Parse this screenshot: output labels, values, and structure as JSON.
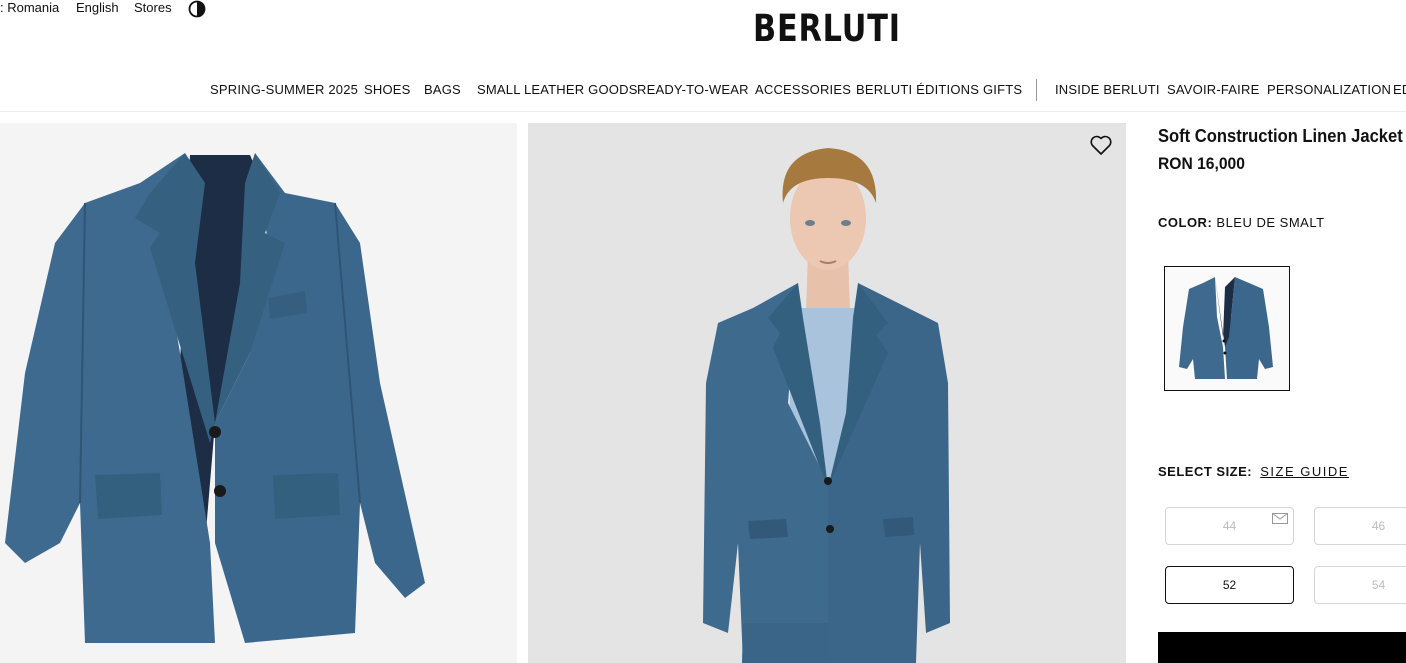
{
  "utility": {
    "country": ": Romania",
    "language": "English",
    "stores": "Stores"
  },
  "brand": "BERLUTI",
  "nav": {
    "items": [
      "SPRING-SUMMER 2025",
      "SHOES",
      "BAGS",
      "SMALL LEATHER GOODS",
      "READY-TO-WEAR",
      "ACCESSORIES",
      "BERLUTI ÉDITIONS",
      "GIFTS",
      "INSIDE BERLUTI",
      "SAVOIR-FAIRE",
      "PERSONALIZATION",
      "ED"
    ]
  },
  "product": {
    "name": "Soft Construction Linen Jacket",
    "price": "RON 16,000",
    "color_label": "COLOR:",
    "color_value": "BLEU DE SMALT",
    "size_label": "SELECT SIZE:",
    "size_guide": "SIZE GUIDE",
    "sizes": [
      "44",
      "46",
      "52",
      "54"
    ],
    "selected_size": "52"
  },
  "icons": {
    "theme": "contrast-icon",
    "wishlist": "heart-icon",
    "notify": "mail-icon"
  },
  "colors": {
    "jacket": "#3f6a8f",
    "jacket_dark": "#2e5576",
    "tshirt": "#a9c3dc",
    "text": "#111111"
  }
}
